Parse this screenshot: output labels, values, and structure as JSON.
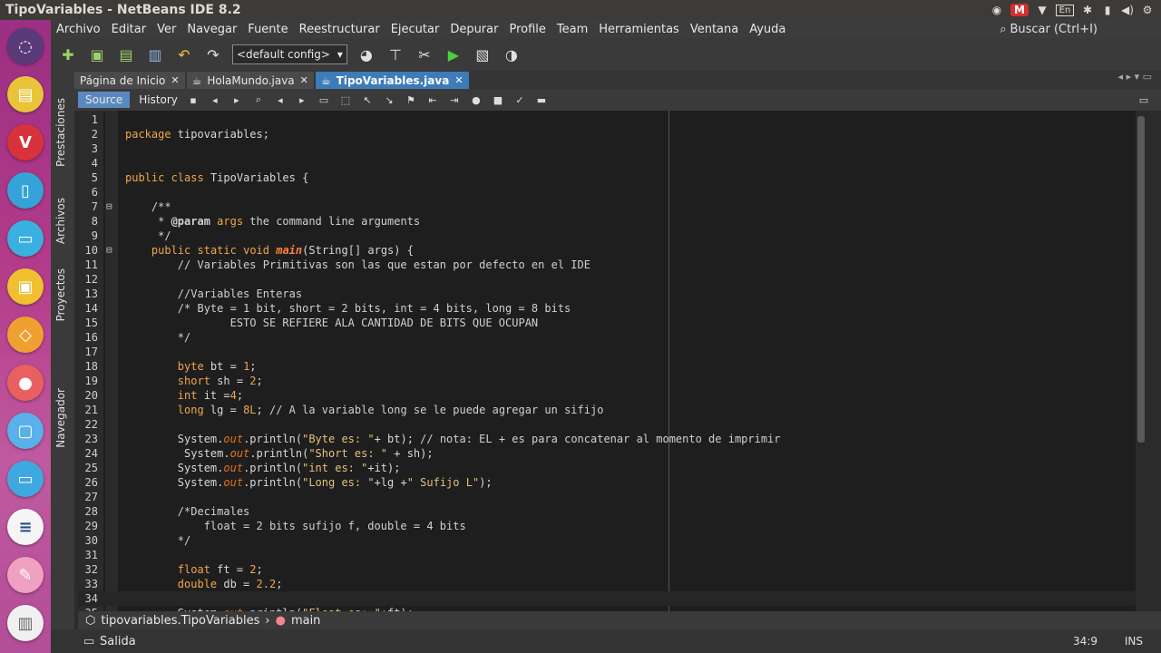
{
  "window": {
    "title": "TipoVariables - NetBeans IDE 8.2"
  },
  "tray": {
    "icons": [
      "camera-icon",
      "gmail-icon",
      "wifi-icon",
      "keyboard-layout-icon",
      "bluetooth-icon",
      "battery-icon",
      "volume-icon",
      "settings-icon"
    ],
    "keyboard": "En",
    "gmail": "M"
  },
  "menu": {
    "items": [
      "Archivo",
      "Editar",
      "Ver",
      "Navegar",
      "Fuente",
      "Reestructurar",
      "Ejecutar",
      "Depurar",
      "Profile",
      "Team",
      "Herramientas",
      "Ventana",
      "Ayuda"
    ],
    "search_placeholder": "Buscar (Ctrl+I)"
  },
  "toolbar": {
    "config": "<default config>"
  },
  "left_tabs": [
    "Prestaciones",
    "Archivos",
    "Proyectos",
    "Navegador"
  ],
  "tabs": [
    {
      "label": "Página de Inicio",
      "active": false
    },
    {
      "label": "HolaMundo.java",
      "active": false
    },
    {
      "label": "TipoVariables.java",
      "active": true
    }
  ],
  "editor_toolbar": {
    "source": "Source",
    "history": "History"
  },
  "code_lines": [
    {
      "n": "1",
      "t": ""
    },
    {
      "n": "2",
      "t": "package tipovariables;"
    },
    {
      "n": "3",
      "t": ""
    },
    {
      "n": "4",
      "t": ""
    },
    {
      "n": "5",
      "t": "public class TipoVariables {"
    },
    {
      "n": "6",
      "t": ""
    },
    {
      "n": "7",
      "t": "    /**"
    },
    {
      "n": "8",
      "t": "     * @param args the command line arguments"
    },
    {
      "n": "9",
      "t": "     */"
    },
    {
      "n": "10",
      "t": "    public static void main(String[] args) {"
    },
    {
      "n": "11",
      "t": "        // Variables Primitivas son las que estan por defecto en el IDE"
    },
    {
      "n": "12",
      "t": ""
    },
    {
      "n": "13",
      "t": "        //Variables Enteras"
    },
    {
      "n": "14",
      "t": "        /* Byte = 1 bit, short = 2 bits, int = 4 bits, long = 8 bits"
    },
    {
      "n": "15",
      "t": "                ESTO SE REFIERE ALA CANTIDAD DE BITS QUE OCUPAN"
    },
    {
      "n": "16",
      "t": "        */"
    },
    {
      "n": "17",
      "t": ""
    },
    {
      "n": "18",
      "t": "        byte bt = 1;"
    },
    {
      "n": "19",
      "t": "        short sh = 2;"
    },
    {
      "n": "20",
      "t": "        int it =4;"
    },
    {
      "n": "21",
      "t": "        long lg = 8L; // A la variable long se le puede agregar un sifijo"
    },
    {
      "n": "22",
      "t": ""
    },
    {
      "n": "23",
      "t": "        System.out.println(\"Byte es: \"+ bt); // nota: EL + es para concatenar al momento de imprimir"
    },
    {
      "n": "24",
      "t": "         System.out.println(\"Short es: \" + sh);"
    },
    {
      "n": "25",
      "t": "        System.out.println(\"int es: \"+it);"
    },
    {
      "n": "26",
      "t": "        System.out.println(\"Long es: \"+lg +\" Sufijo L\");"
    },
    {
      "n": "27",
      "t": ""
    },
    {
      "n": "28",
      "t": "        /*Decimales"
    },
    {
      "n": "29",
      "t": "            float = 2 bits sufijo f, double = 4 bits"
    },
    {
      "n": "30",
      "t": "        */"
    },
    {
      "n": "31",
      "t": ""
    },
    {
      "n": "32",
      "t": "        float ft = 2;"
    },
    {
      "n": "33",
      "t": "        double db = 2.2;"
    },
    {
      "n": "34",
      "t": "        "
    },
    {
      "n": "35",
      "t": "        System.out.println(\"Float es: \"+ft);"
    }
  ],
  "breadcrumb": {
    "class": "tipovariables.TipoVariables",
    "method": "main"
  },
  "status": {
    "output": "Salida",
    "position": "34:9",
    "mode": "INS"
  }
}
